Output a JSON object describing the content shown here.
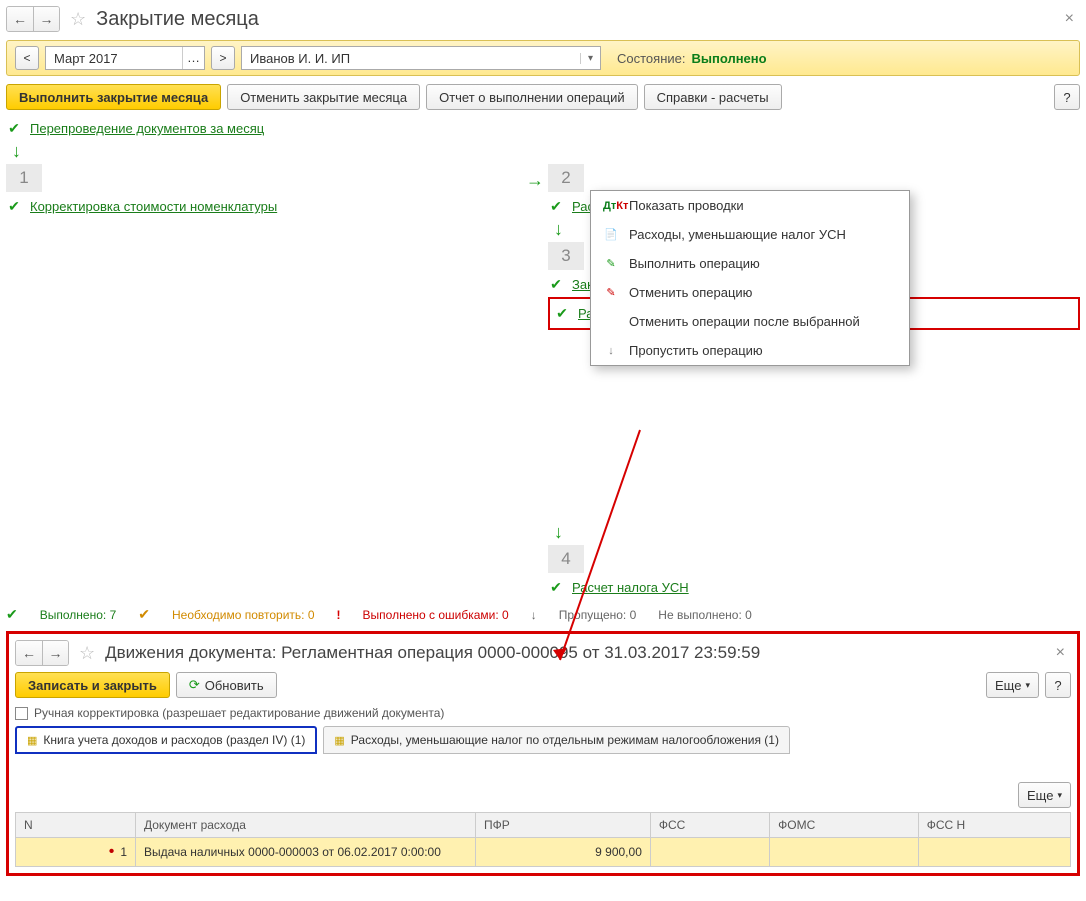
{
  "header": {
    "title": "Закрытие месяца"
  },
  "period": {
    "value": "Март 2017",
    "org": "Иванов И. И. ИП",
    "state_label": "Состояние:",
    "state_value": "Выполнено"
  },
  "toolbar": {
    "run": "Выполнить закрытие месяца",
    "cancel": "Отменить закрытие месяца",
    "report": "Отчет о выполнении операций",
    "spravki": "Справки - расчеты",
    "help": "?"
  },
  "flow": {
    "repost": "Перепроведение документов за месяц",
    "step1": "1",
    "step1_item": "Корректировка стоимости номенклатуры",
    "step2": "2",
    "step2_item": "Расчет долей списания косвенных расходов",
    "step3": "3",
    "step3_item1": "Закрытие счета 44 \"Издержки обращения\"",
    "step3_item2": "Расчет расходов, уменьшающих налог УСН",
    "step4": "4",
    "step4_item": "Расчет налога УСН"
  },
  "context_menu": {
    "items": [
      "Показать проводки",
      "Расходы, уменьшающие налог УСН",
      "Выполнить операцию",
      "Отменить операцию",
      "Отменить операции после выбранной",
      "Пропустить операцию"
    ]
  },
  "status": {
    "done_label": "Выполнено:",
    "done_n": "7",
    "repeat_label": "Необходимо повторить:",
    "repeat_n": "0",
    "err_label": "Выполнено с ошибками:",
    "err_n": "0",
    "skip_label": "Пропущено:",
    "skip_n": "0",
    "not_label": "Не выполнено:",
    "not_n": "0"
  },
  "panel2": {
    "title": "Движения документа: Регламентная операция 0000-000095 от 31.03.2017 23:59:59",
    "save_close": "Записать и закрыть",
    "refresh": "Обновить",
    "more": "Еще",
    "help": "?",
    "manual_chk": "Ручная корректировка (разрешает редактирование движений документа)",
    "tab1": "Книга учета доходов и расходов (раздел IV) (1)",
    "tab2": "Расходы, уменьшающие налог по отдельным режимам налогообложения (1)",
    "table": {
      "headers": [
        "N",
        "Документ расхода",
        "ПФР",
        "ФСС",
        "ФОМС",
        "ФСС Н"
      ],
      "row": {
        "n": "1",
        "doc": "Выдача наличных 0000-000003 от 06.02.2017 0:00:00",
        "pfr": "9 900,00",
        "fss": "",
        "foms": "",
        "fssn": ""
      }
    }
  }
}
